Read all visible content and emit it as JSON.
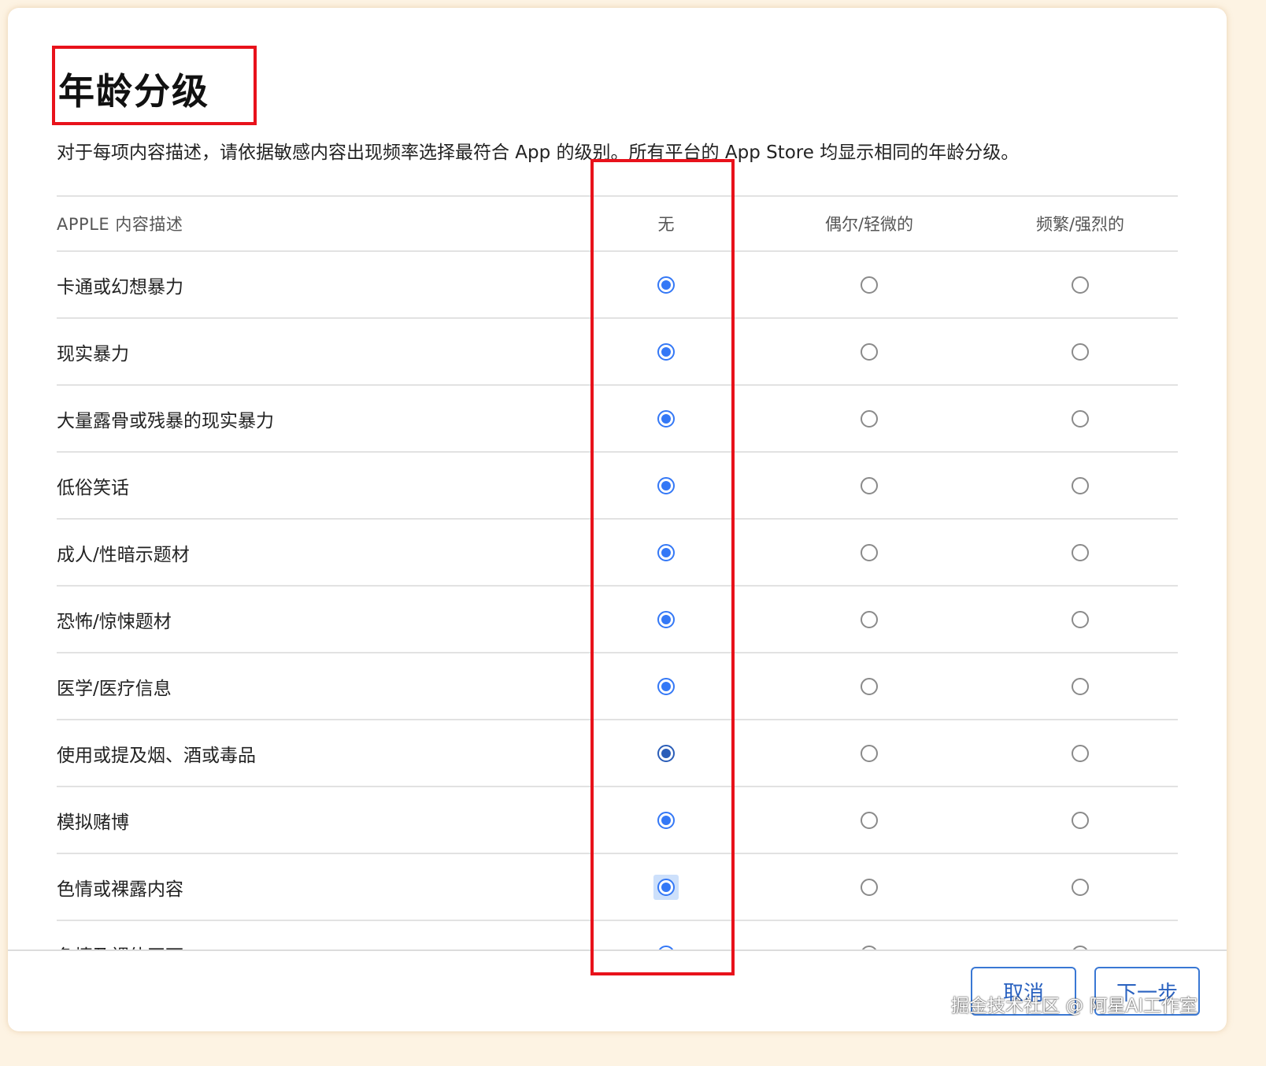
{
  "title": "年龄分级",
  "description": "对于每项内容描述，请依据敏感内容出现频率选择最符合 App 的级别。所有平台的 App Store 均显示相同的年龄分级。",
  "table": {
    "headers": {
      "label": "APPLE 内容描述",
      "none": "无",
      "infrequent": "偶尔/轻微的",
      "frequent": "频繁/强烈的"
    },
    "rows": [
      {
        "label": "卡通或幻想暴力",
        "selected": "none"
      },
      {
        "label": "现实暴力",
        "selected": "none"
      },
      {
        "label": "大量露骨或残暴的现实暴力",
        "selected": "none"
      },
      {
        "label": "低俗笑话",
        "selected": "none"
      },
      {
        "label": "成人/性暗示题材",
        "selected": "none"
      },
      {
        "label": "恐怖/惊悚题材",
        "selected": "none"
      },
      {
        "label": "医学/医疗信息",
        "selected": "none"
      },
      {
        "label": "使用或提及烟、酒或毒品",
        "selected": "none"
      },
      {
        "label": "模拟赌博",
        "selected": "none"
      },
      {
        "label": "色情或裸露内容",
        "selected": "none"
      },
      {
        "label": "色情及裸体画面",
        "selected": "none"
      }
    ]
  },
  "buttons": {
    "cancel": "取消",
    "next": "下一步"
  },
  "watermark": "掘金技术社区 @ 阿星AI工作室",
  "colors": {
    "accent": "#3478f6",
    "highlight": "#e8121b"
  }
}
